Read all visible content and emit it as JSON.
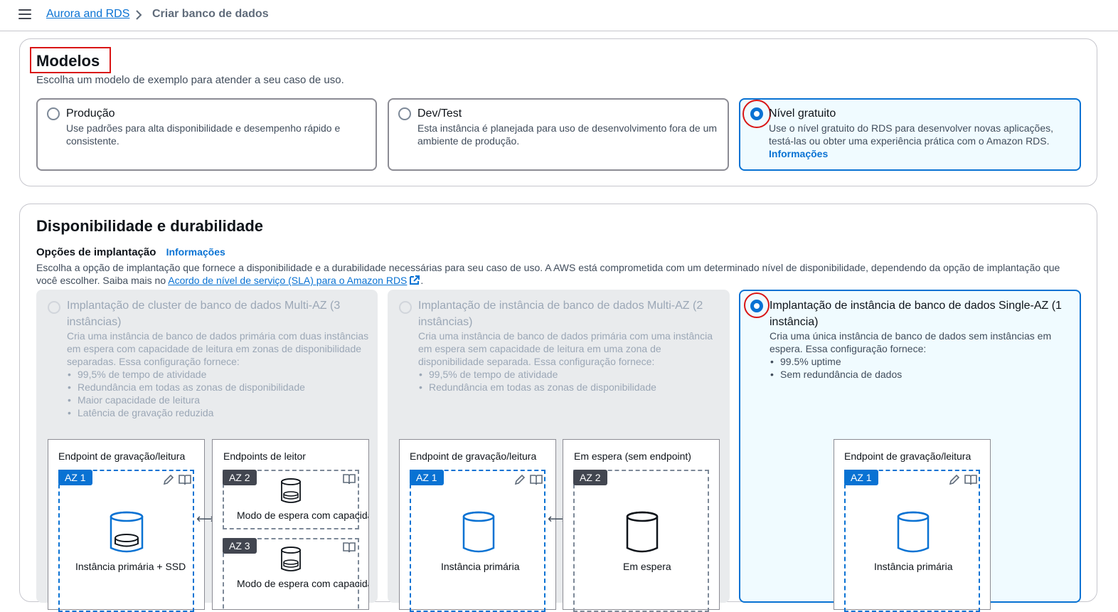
{
  "topbar": {
    "breadcrumb_root": "Aurora and RDS",
    "breadcrumb_current": "Criar banco de dados"
  },
  "models": {
    "title": "Modelos",
    "description": "Escolha um modelo de exemplo para atender a seu caso de uso.",
    "options": [
      {
        "title": "Produção",
        "desc": "Use padrões para alta disponibilidade e desempenho rápido e consistente.",
        "selected": false
      },
      {
        "title": "Dev/Test",
        "desc": "Esta instância é planejada para uso de desenvolvimento fora de um ambiente de produção.",
        "selected": false
      },
      {
        "title": "Nível gratuito",
        "desc": "Use o nível gratuito do RDS para desenvolver novas aplicações, testá-las ou obter uma experiência prática com o Amazon RDS.",
        "link": "Informações",
        "selected": true
      }
    ]
  },
  "availability": {
    "title": "Disponibilidade e durabilidade",
    "deploy_label": "Opções de implantação",
    "info_link": "Informações",
    "desc_prefix": "Escolha a opção de implantação que fornece a disponibilidade e a durabilidade necessárias para seu caso de uso. A AWS está comprometida com um determinado nível de disponibilidade, dependendo da opção de implantação que você escolher. Saiba mais no ",
    "desc_link": "Acordo de nível de serviço (SLA) para o Amazon RDS",
    "desc_suffix": ".",
    "options": [
      {
        "title": "Implantação de cluster de banco de dados Multi-AZ (3 instâncias)",
        "desc": "Cria uma instância de banco de dados primária com duas instâncias em espera com capacidade de leitura em zonas de disponibilidade separadas. Essa configuração fornece:",
        "bullets": [
          "99,5% de tempo de atividade",
          "Redundância em todas as zonas de disponibilidade",
          "Maior capacidade de leitura",
          "Latência de gravação reduzida"
        ],
        "disabled": true,
        "diagram": {
          "box1_label": "Endpoint de gravação/leitura",
          "box2_label": "Endpoints de leitor",
          "az1": "AZ 1",
          "az2": "AZ 2",
          "az3": "AZ 3",
          "primary_label": "Instância primária + SSD",
          "standby_label_1": "Modo de espera com capacidade de leitura",
          "standby_label_2": "Modo de espera com capacidade de leitura"
        }
      },
      {
        "title": "Implantação de instância de banco de dados Multi-AZ (2 instâncias)",
        "desc": "Cria uma instância de banco de dados primária com uma instância em espera sem capacidade de leitura em uma zona de disponibilidade separada. Essa configuração fornece:",
        "bullets": [
          "99,5% de tempo de atividade",
          "Redundância em todas as zonas de disponibilidade"
        ],
        "disabled": true,
        "diagram": {
          "box1_label": "Endpoint de gravação/leitura",
          "box2_label": "Em espera (sem endpoint)",
          "az1": "AZ 1",
          "az2": "AZ 2",
          "primary_label": "Instância primária",
          "standby_label": "Em espera"
        }
      },
      {
        "title": "Implantação de instância de banco de dados Single-AZ (1 instância)",
        "desc": "Cria uma única instância de banco de dados sem instâncias em espera. Essa configuração fornece:",
        "bullets": [
          "99.5% uptime",
          "Sem redundância de dados"
        ],
        "selected": true,
        "diagram": {
          "box1_label": "Endpoint de gravação/leitura",
          "az1": "AZ 1",
          "primary_label": "Instância primária"
        }
      }
    ]
  },
  "colors": {
    "accent": "#0972d3",
    "annotation": "#d91515",
    "selected_bg": "#f0fbff",
    "disabled_bg": "#e9ebed"
  }
}
